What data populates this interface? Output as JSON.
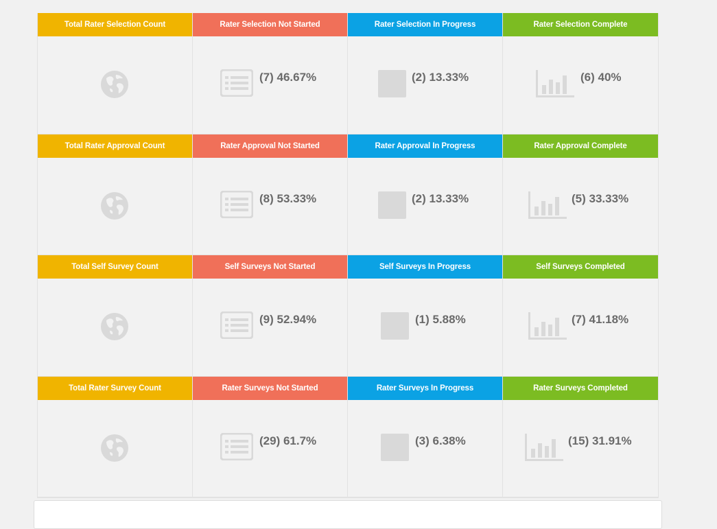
{
  "colors": {
    "total": "#f0b400",
    "not_started": "#f07059",
    "in_progress": "#0ba2e4",
    "complete": "#7cbc22",
    "icon": "#d9d9d9",
    "value_text": "#6a6a6a"
  },
  "icons": {
    "total": "globe-icon",
    "not_started": "list-icon",
    "in_progress": "square-icon",
    "complete": "bar-chart-icon"
  },
  "rows": [
    {
      "total": {
        "title": "Total Rater Selection Count"
      },
      "not_started": {
        "title": "Rater Selection Not Started",
        "value": "(7) 46.67%"
      },
      "in_progress": {
        "title": "Rater Selection In Progress",
        "value": "(2) 13.33%"
      },
      "complete": {
        "title": "Rater Selection Complete",
        "value": "(6) 40%"
      }
    },
    {
      "total": {
        "title": "Total Rater Approval Count"
      },
      "not_started": {
        "title": "Rater Approval Not Started",
        "value": "(8) 53.33%"
      },
      "in_progress": {
        "title": "Rater Approval In Progress",
        "value": "(2) 13.33%"
      },
      "complete": {
        "title": "Rater Approval Complete",
        "value": "(5) 33.33%"
      }
    },
    {
      "total": {
        "title": "Total Self Survey Count"
      },
      "not_started": {
        "title": "Self Surveys Not Started",
        "value": "(9) 52.94%"
      },
      "in_progress": {
        "title": "Self Surveys In Progress",
        "value": "(1) 5.88%"
      },
      "complete": {
        "title": "Self Surveys Completed",
        "value": "(7) 41.18%"
      }
    },
    {
      "total": {
        "title": "Total Rater Survey Count"
      },
      "not_started": {
        "title": "Rater Surveys Not Started",
        "value": "(29) 61.7%"
      },
      "in_progress": {
        "title": "Rater Surveys In Progress",
        "value": "(3) 6.38%"
      },
      "complete": {
        "title": "Rater Surveys Completed",
        "value": "(15) 31.91%"
      }
    }
  ]
}
